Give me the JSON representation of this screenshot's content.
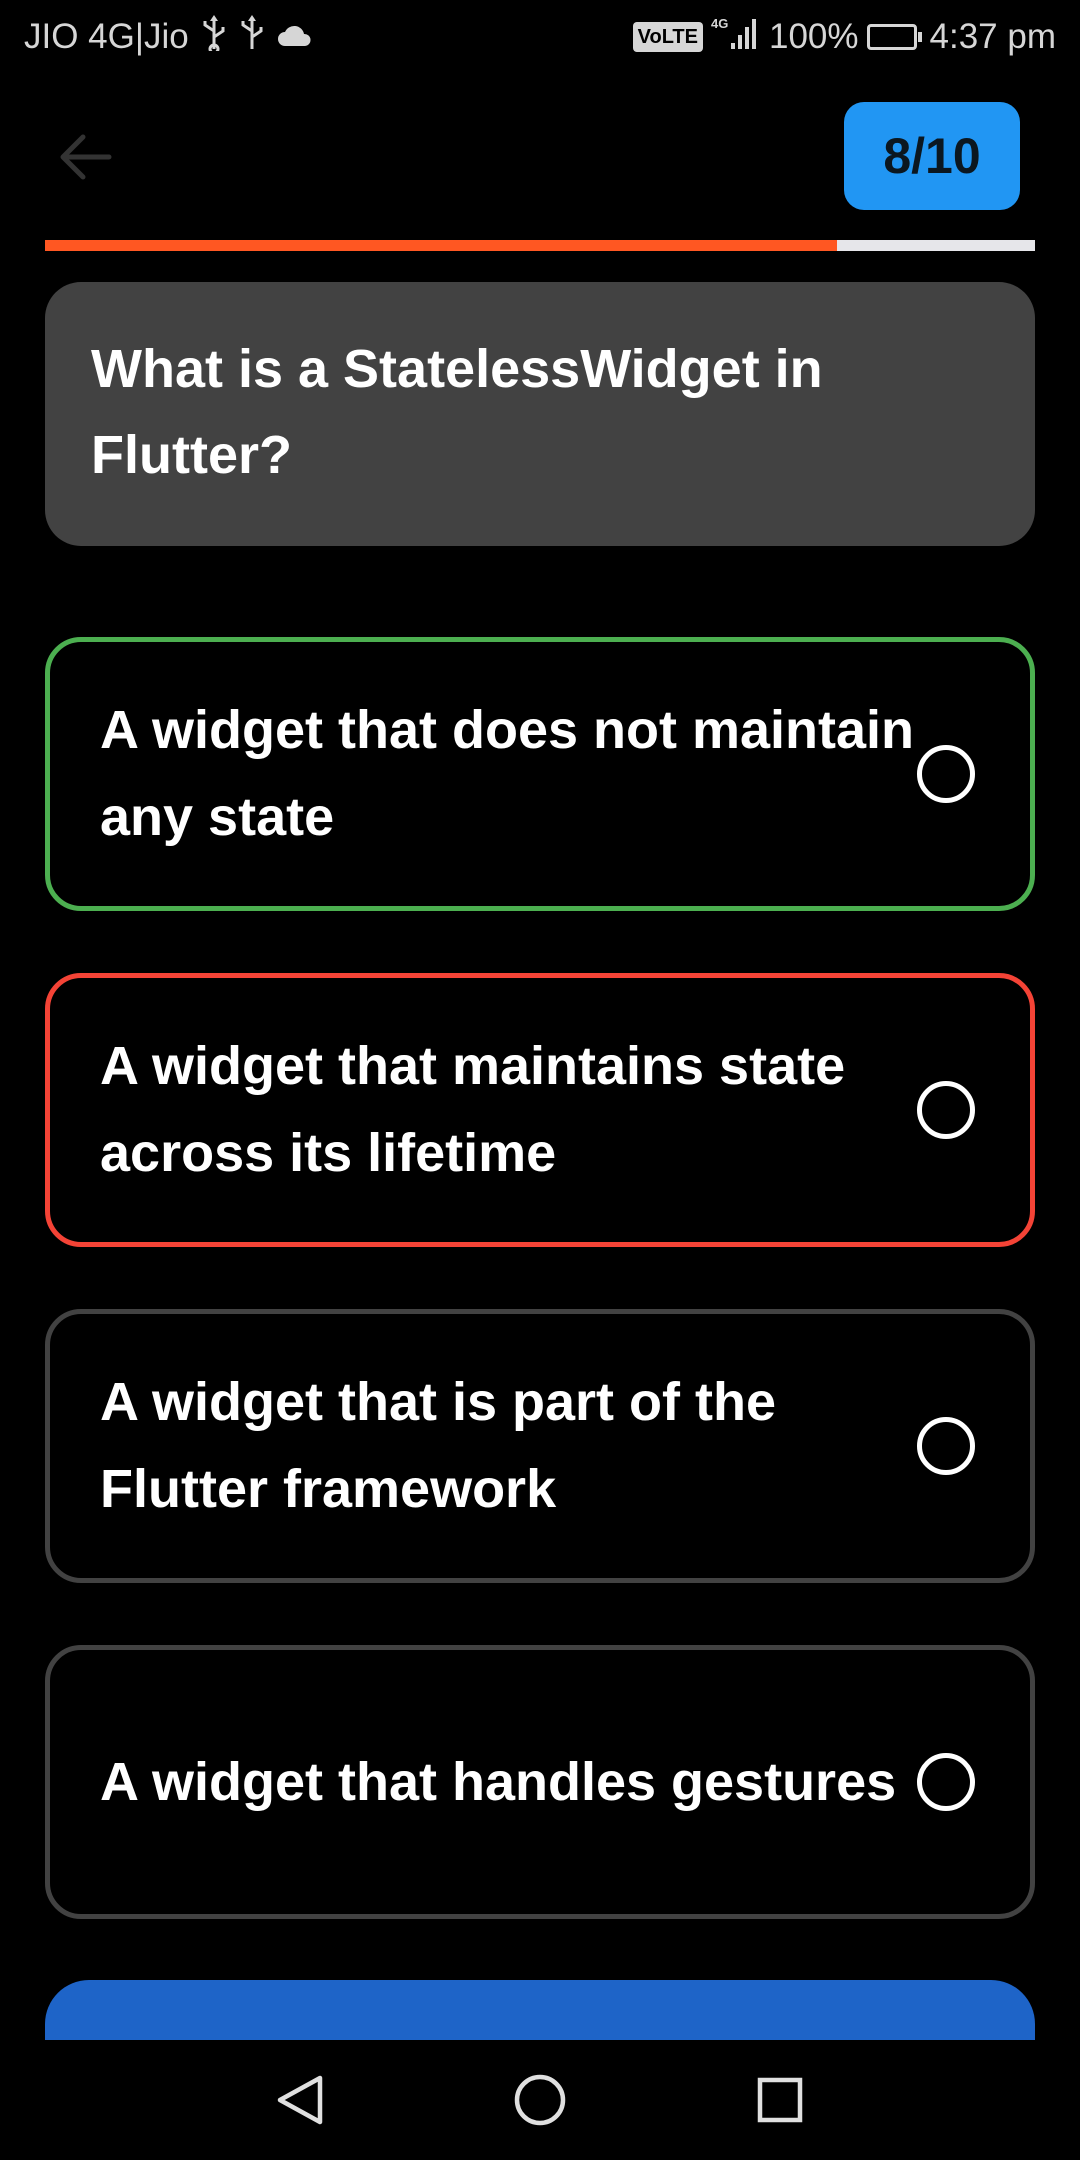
{
  "status_bar": {
    "carrier": "JIO 4G|Jio",
    "volte": "VoLTE",
    "network": "4G",
    "battery_percent": "100%",
    "time": "4:37 pm",
    "battery_level": 1.0
  },
  "header": {
    "counter": "8/10"
  },
  "progress": {
    "fraction": 0.8,
    "fill_color": "#ff5722",
    "track_color": "#e6e6ea"
  },
  "question": {
    "text": "What is a StatelessWidget in Flutter?"
  },
  "options": [
    {
      "text": "A widget that does not maintain any state",
      "state": "correct"
    },
    {
      "text": "A widget that maintains state across its lifetime",
      "state": "wrong"
    },
    {
      "text": "A widget that is part of the Flutter framework",
      "state": "neutral"
    },
    {
      "text": "A widget that handles gestures",
      "state": "neutral"
    }
  ],
  "colors": {
    "correct": "#4caf50",
    "wrong": "#f44336",
    "neutral": "#424242",
    "accent": "#2196f3",
    "button": "#1e64c8"
  },
  "nav_bar": {
    "icons": [
      "back-triangle-icon",
      "home-circle-icon",
      "recents-square-icon"
    ]
  }
}
